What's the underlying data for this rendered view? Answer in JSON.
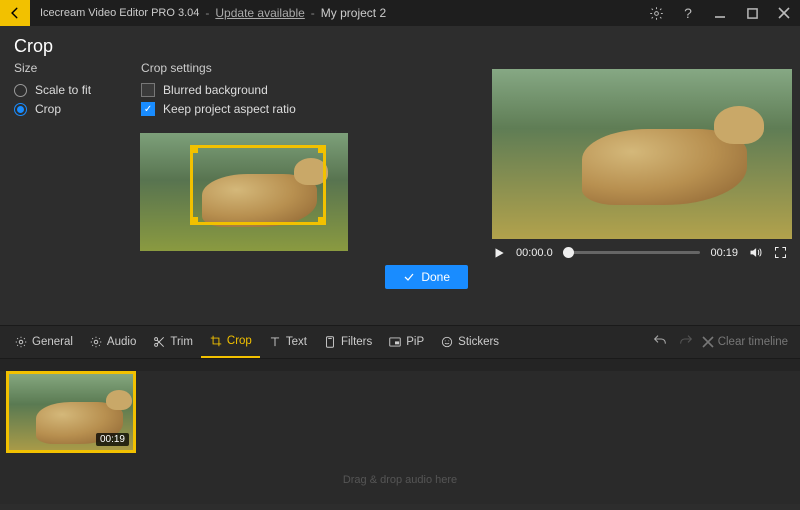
{
  "titlebar": {
    "app": "Icecream Video Editor PRO 3.04",
    "update": "Update available",
    "project": "My project 2"
  },
  "panel_title": "Crop",
  "size": {
    "header": "Size",
    "scale": "Scale to fit",
    "crop": "Crop"
  },
  "settings": {
    "header": "Crop settings",
    "blurred": "Blurred background",
    "keep_ratio": "Keep project aspect ratio"
  },
  "done_label": "Done",
  "player": {
    "current": "00:00.0",
    "total": "00:19"
  },
  "tabs": {
    "general": "General",
    "audio": "Audio",
    "trim": "Trim",
    "crop": "Crop",
    "text": "Text",
    "filters": "Filters",
    "pip": "PiP",
    "stickers": "Stickers"
  },
  "clear_timeline": "Clear timeline",
  "clip_duration": "00:19",
  "drag_hint": "Drag & drop audio here"
}
